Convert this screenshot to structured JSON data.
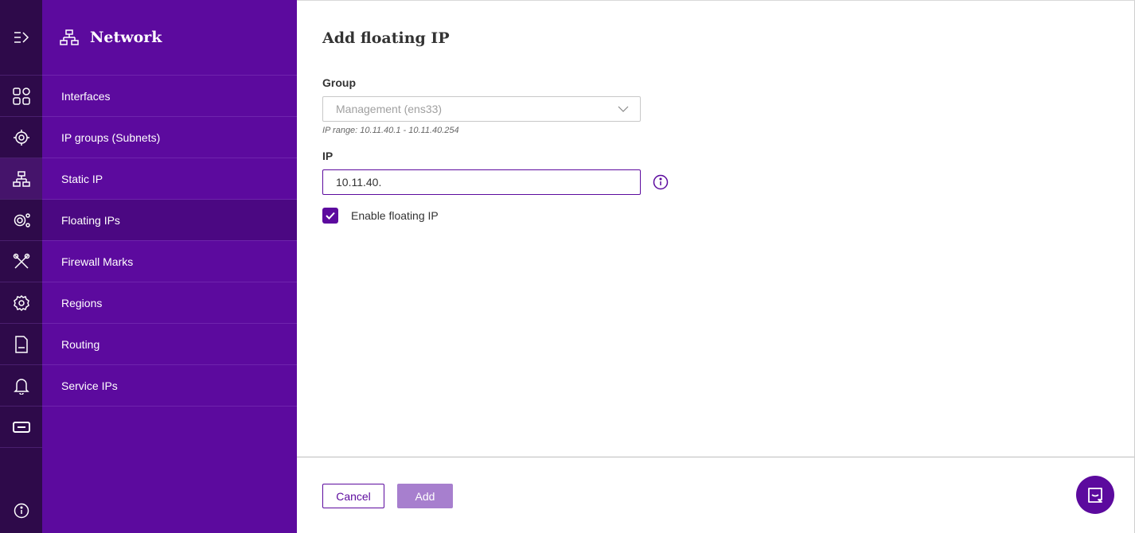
{
  "nav": {
    "title": "Network",
    "items": [
      {
        "label": "Interfaces",
        "icon": "grid-icon"
      },
      {
        "label": "IP groups (Subnets)",
        "icon": "location-gear-icon"
      },
      {
        "label": "Static IP",
        "icon": "network-icon"
      },
      {
        "label": "Floating IPs",
        "icon": "gear-nodes-icon"
      },
      {
        "label": "Firewall Marks",
        "icon": "tools-icon"
      },
      {
        "label": "Regions",
        "icon": "gear-icon"
      },
      {
        "label": "Routing",
        "icon": "log-file-icon"
      },
      {
        "label": "Service IPs",
        "icon": "bell-icon"
      }
    ],
    "active": "Floating IPs"
  },
  "form": {
    "title": "Add floating IP",
    "group_label": "Group",
    "group_value": "Management (ens33)",
    "ip_range_hint": "IP range: 10.11.40.1 - 10.11.40.254",
    "ip_label": "IP",
    "ip_value": "10.11.40.",
    "enable_label": "Enable floating IP",
    "enable_checked": true
  },
  "footer": {
    "cancel_label": "Cancel",
    "add_label": "Add"
  },
  "colors": {
    "accent": "#5c0a9e",
    "rail": "#2e0a4a",
    "add_disabled": "#a77fce"
  }
}
